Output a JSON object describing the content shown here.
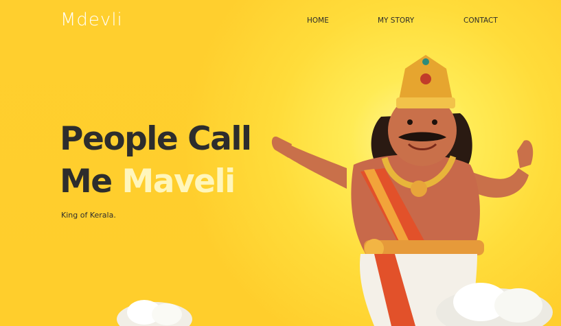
{
  "header": {
    "logo_text": "Mdevli",
    "nav": [
      {
        "label": "HOME"
      },
      {
        "label": "MY STORY"
      },
      {
        "label": "CONTACT"
      }
    ]
  },
  "hero": {
    "title_line1": "People Call",
    "title_line2_prefix": "Me ",
    "title_line2_accent": "Maveli",
    "tagline": "King of Kerala."
  },
  "colors": {
    "background": "#FFCE2D",
    "title": "#2D2D2D",
    "accent": "#FFF6BC",
    "nav_text": "#2B2B2B"
  },
  "illustration": {
    "subject": "mahabali-character-illustration"
  }
}
